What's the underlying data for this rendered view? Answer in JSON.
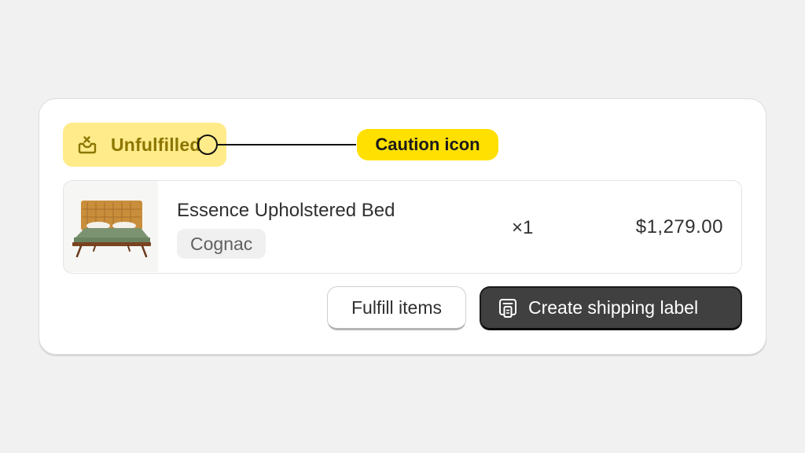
{
  "order": {
    "status": {
      "label": "Unfulfilled",
      "icon": "inbox-caution-icon",
      "background_color": "#ffeb8a",
      "text_color": "#8c7600"
    },
    "annotation": {
      "label": "Caution icon",
      "background_color": "#ffe000"
    },
    "line_item": {
      "image": "upholstered-bed-thumbnail",
      "title": "Essence Upholstered Bed",
      "variant": "Cognac",
      "quantity": "×1",
      "price": "$1,279.00"
    },
    "actions": {
      "fulfill_label": "Fulfill items",
      "shipping_label": "Create shipping label",
      "shipping_icon": "shipping-label-icon",
      "primary_color": "#404040"
    }
  }
}
